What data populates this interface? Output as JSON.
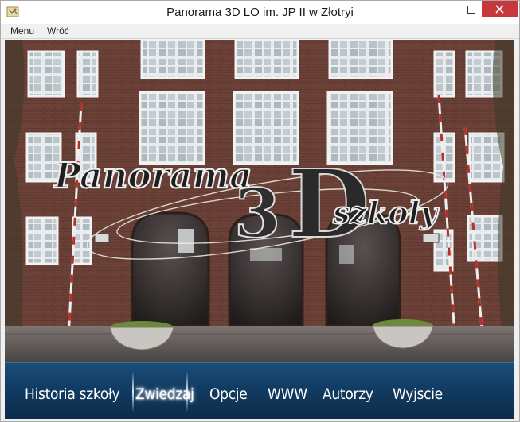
{
  "window": {
    "title": "Panorama 3D LO im. JP II w Złotryi",
    "icon": "map-icon"
  },
  "menubar": {
    "items": [
      {
        "label": "Menu"
      },
      {
        "label": "Wróć"
      }
    ]
  },
  "splash": {
    "line1": "Panorama",
    "logo_3": "3",
    "logo_d": "D",
    "line2": "szkoły"
  },
  "nav": {
    "items": [
      {
        "label": "Historia szkoły"
      },
      {
        "label": "Zwiedzaj",
        "active": true
      },
      {
        "label": "Opcje"
      },
      {
        "label": "WWW"
      },
      {
        "label": "Autorzy"
      },
      {
        "label": "Wyjscie"
      }
    ]
  },
  "colors": {
    "close_button": "#c7373c",
    "nav_background": "#123c63",
    "brick": "#7a4a3e"
  }
}
